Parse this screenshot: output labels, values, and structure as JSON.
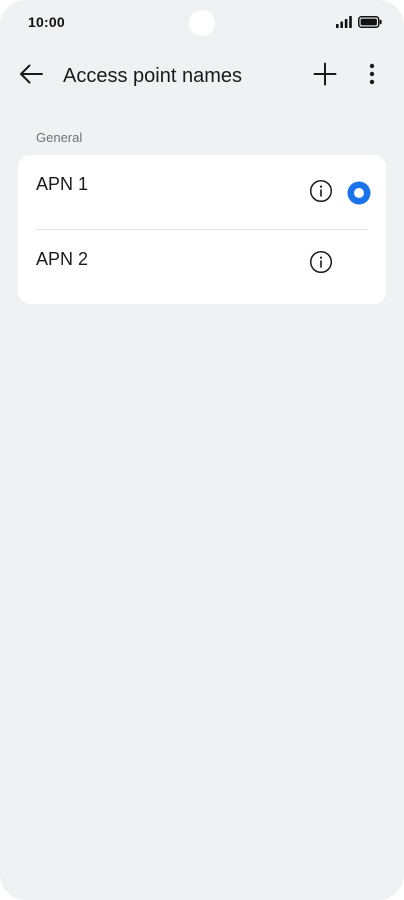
{
  "status_bar": {
    "time": "10:00",
    "icons": [
      "signal-icon",
      "battery-icon"
    ]
  },
  "app_bar": {
    "title": "Access point names",
    "back_icon": "arrow-left-icon",
    "add_icon": "plus-icon",
    "more_icon": "more-vertical-icon"
  },
  "section": {
    "label": "General"
  },
  "apn_list": [
    {
      "name": "APN 1",
      "selected": true,
      "info_icon": "info-icon"
    },
    {
      "name": "APN 2",
      "selected": false,
      "info_icon": "info-icon"
    }
  ],
  "colors": {
    "background": "#f0f1f3",
    "card": "#ffffff",
    "accent": "#1a73e8",
    "text_primary": "#1a1a1a",
    "text_secondary": "#6f7277"
  }
}
